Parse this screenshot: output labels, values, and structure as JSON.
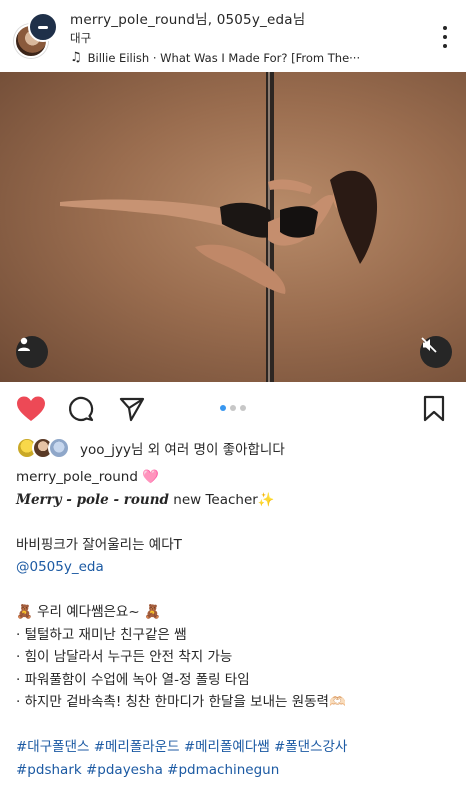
{
  "post": {
    "header": {
      "users": "merry_pole_round님, 0505y_eda님",
      "location": "대구",
      "music_note": "♫",
      "music": "Billie Eilish · What Was I Made For? [From The···"
    },
    "likes_text": "yoo_jyy님 외 여러 명이 좋아합니다",
    "carousel": {
      "count": 3,
      "active": 1
    },
    "caption": {
      "username": "merry_pole_round",
      "username_emoji": "🩷",
      "brand": "Merry - pole - round",
      "brand_suffix": "new Teacher",
      "brand_emoji": "✨",
      "line1": "바비핑크가 잘어울리는 예다T",
      "mention": "@0505y_eda",
      "intro_emoji": "🧸",
      "intro": "우리 예다쌤은요~",
      "intro_emoji2": "🧸",
      "bullets": [
        "· 털털하고 재미난 친구같은 쌤",
        "· 힘이 남달라서 누구든 안전 착지 가능",
        "· 파워풀함이 수업에 녹아 열-정 폴링 타임",
        "· 하지만 겉바속촉! 칭찬 한마디가 한달을 보내는 원동력"
      ],
      "last_emoji": "🫶🏻",
      "hashtags1": "#대구폴댄스 #메리폴라운드 #메리폴예다쌤 #폴댄스강사",
      "hashtags2": "#pdshark #pdayesha #pdmachinegun"
    }
  }
}
